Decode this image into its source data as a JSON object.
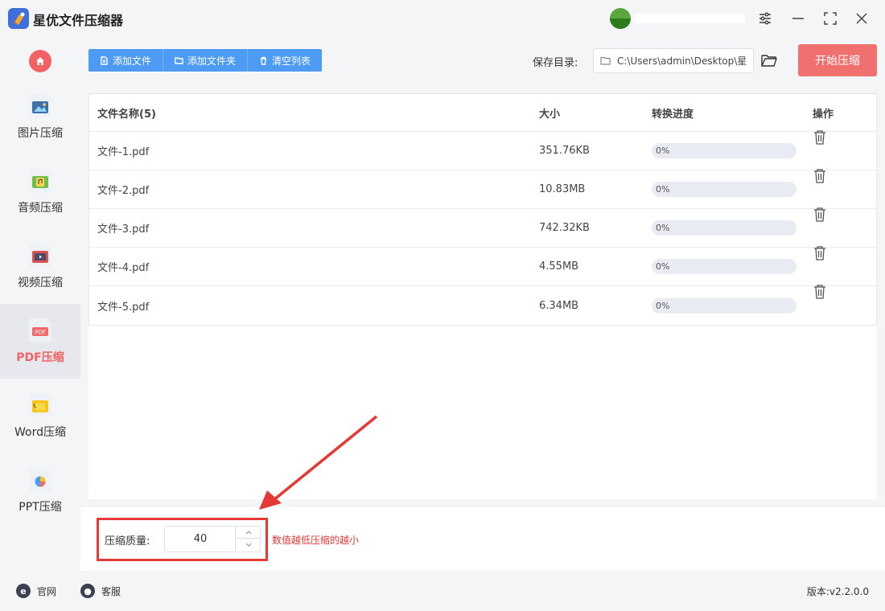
{
  "app": {
    "title": "星优文件压缩器"
  },
  "sidebar": {
    "items": [
      {
        "label": "图片压缩",
        "icon": "image-compress-icon"
      },
      {
        "label": "音频压缩",
        "icon": "audio-compress-icon"
      },
      {
        "label": "视频压缩",
        "icon": "video-compress-icon"
      },
      {
        "label": "PDF压缩",
        "icon": "pdf-compress-icon",
        "active": true
      },
      {
        "label": "Word压缩",
        "icon": "word-compress-icon"
      },
      {
        "label": "PPT压缩",
        "icon": "ppt-compress-icon"
      }
    ]
  },
  "toolbar": {
    "add_file": "添加文件",
    "add_folder": "添加文件夹",
    "clear_list": "清空列表",
    "save_dir_label": "保存目录:",
    "save_dir_path": "C:\\Users\\admin\\Desktop\\星",
    "start": "开始压缩"
  },
  "table": {
    "headers": {
      "name": "文件名称(5)",
      "size": "大小",
      "progress": "转换进度",
      "action": "操作"
    },
    "rows": [
      {
        "name": "文件-1.pdf",
        "size": "351.76KB",
        "progress": "0%",
        "progress_value": 0
      },
      {
        "name": "文件-2.pdf",
        "size": "10.83MB",
        "progress": "0%",
        "progress_value": 0
      },
      {
        "name": "文件-3.pdf",
        "size": "742.32KB",
        "progress": "0%",
        "progress_value": 0
      },
      {
        "name": "文件-4.pdf",
        "size": "4.55MB",
        "progress": "0%",
        "progress_value": 0
      },
      {
        "name": "文件-5.pdf",
        "size": "6.34MB",
        "progress": "0%",
        "progress_value": 0
      }
    ]
  },
  "quality": {
    "label": "压缩质量:",
    "value": "40",
    "hint": "数值越低压缩的越小"
  },
  "statusbar": {
    "website": "官网",
    "support": "客服",
    "version": "版本:v2.2.0.0"
  },
  "colors": {
    "accent_blue": "#4d9bf5",
    "start_red": "#f07070",
    "active_red": "#f26262",
    "annotation_red": "#e53935"
  }
}
